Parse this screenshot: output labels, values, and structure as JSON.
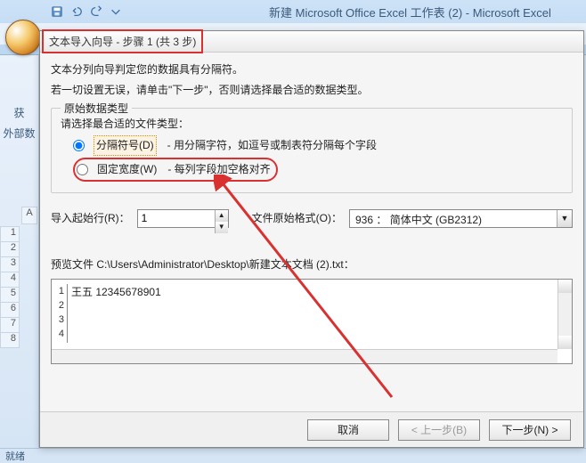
{
  "window": {
    "title": "新建 Microsoft Office Excel 工作表 (2) - Microsoft Excel"
  },
  "left_panel": {
    "line1": "获",
    "line2": "外部数"
  },
  "status_bar": {
    "text": "就绪"
  },
  "dialog": {
    "title": "文本导入向导 - 步骤 1 (共 3 步)",
    "intro_line1": "文本分列向导判定您的数据具有分隔符。",
    "intro_line2": "若一切设置无误，请单击\"下一步\"，否则请选择最合适的数据类型。",
    "group_legend": "原始数据类型",
    "choose_label": "请选择最合适的文件类型：",
    "radio_delimited_label": "分隔符号(D)",
    "radio_delimited_desc": "- 用分隔字符，如逗号或制表符分隔每个字段",
    "radio_fixed_label": "固定宽度(W)",
    "radio_fixed_desc": "- 每列字段加空格对齐",
    "start_row_label": "导入起始行(R)：",
    "start_row_value": "1",
    "orig_label": "文件原始格式(O)：",
    "orig_value": "936 ： 简体中文 (GB2312)",
    "preview_label": "预览文件 C:\\Users\\Administrator\\Desktop\\新建文本文档 (2).txt：",
    "preview_lines": [
      {
        "n": "1",
        "text": "王五 12345678901"
      },
      {
        "n": "2",
        "text": ""
      },
      {
        "n": "3",
        "text": ""
      },
      {
        "n": "4",
        "text": ""
      }
    ],
    "btn_cancel": "取消",
    "btn_back": "< 上一步(B)",
    "btn_next": "下一步(N) >"
  },
  "grid": {
    "col_header": "A",
    "rows": [
      "1",
      "2",
      "3",
      "4",
      "5",
      "6",
      "7",
      "8"
    ]
  }
}
